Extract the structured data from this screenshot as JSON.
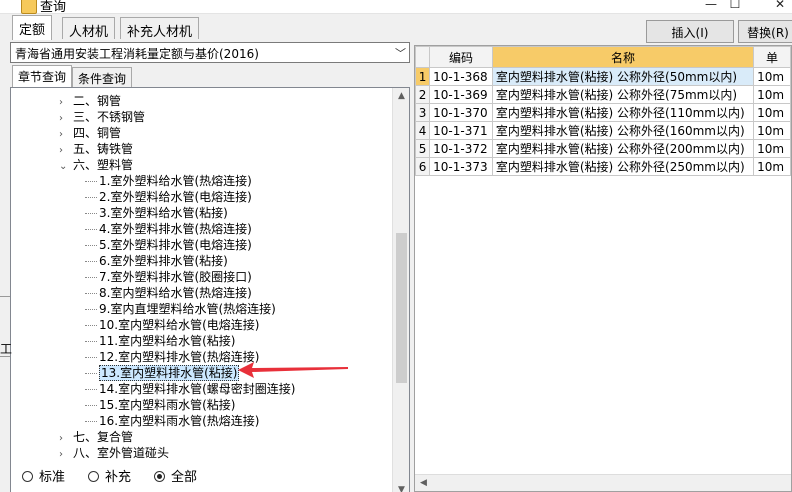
{
  "window": {
    "title": "查询",
    "minimize": "—",
    "maximize": "☐",
    "close": "✕"
  },
  "top_tabs": [
    {
      "label": "定额",
      "active": true
    },
    {
      "label": "人材机",
      "active": false
    },
    {
      "label": "补充人材机",
      "active": false
    }
  ],
  "toolbar": {
    "insert_label": "插入(I)",
    "replace_label": "替换(R)"
  },
  "combo": {
    "value": "青海省通用安装工程消耗量定额与基价(2016)",
    "arrow": "﹀"
  },
  "sub_tabs": [
    {
      "label": "章节查询",
      "active": true
    },
    {
      "label": "条件查询",
      "active": false
    }
  ],
  "tree": {
    "items": [
      {
        "label": "二、钢管",
        "level": 1,
        "expander": "›"
      },
      {
        "label": "三、不锈钢管",
        "level": 1,
        "expander": "›"
      },
      {
        "label": "四、铜管",
        "level": 1,
        "expander": "›"
      },
      {
        "label": "五、铸铁管",
        "level": 1,
        "expander": "›"
      },
      {
        "label": "六、塑料管",
        "level": 1,
        "expander": "⌄"
      },
      {
        "label": "1.室外塑料给水管(热熔连接)",
        "level": 2
      },
      {
        "label": "2.室外塑料给水管(电熔连接)",
        "level": 2
      },
      {
        "label": "3.室外塑料给水管(粘接)",
        "level": 2
      },
      {
        "label": "4.室外塑料排水管(热熔连接)",
        "level": 2
      },
      {
        "label": "5.室外塑料排水管(电熔连接)",
        "level": 2
      },
      {
        "label": "6.室外塑料排水管(粘接)",
        "level": 2
      },
      {
        "label": "7.室外塑料排水管(胶圈接口)",
        "level": 2
      },
      {
        "label": "8.室内塑料给水管(热熔连接)",
        "level": 2
      },
      {
        "label": "9.室内直埋塑料给水管(热熔连接)",
        "level": 2
      },
      {
        "label": "10.室内塑料给水管(电熔连接)",
        "level": 2
      },
      {
        "label": "11.室内塑料给水管(粘接)",
        "level": 2
      },
      {
        "label": "12.室内塑料排水管(热熔连接)",
        "level": 2
      },
      {
        "label": "13.室内塑料排水管(粘接)",
        "level": 2,
        "selected": true
      },
      {
        "label": "14.室内塑料排水管(螺母密封圈连接)",
        "level": 2
      },
      {
        "label": "15.室内塑料雨水管(粘接)",
        "level": 2
      },
      {
        "label": "16.室内塑料雨水管(热熔连接)",
        "level": 2
      },
      {
        "label": "七、复合管",
        "level": 1,
        "expander": "›"
      },
      {
        "label": "八、室外管道碰头",
        "level": 1,
        "expander": "›"
      }
    ]
  },
  "radios": [
    {
      "label": "标准",
      "checked": false
    },
    {
      "label": "补充",
      "checked": false
    },
    {
      "label": "全部",
      "checked": true
    }
  ],
  "grid": {
    "headers": [
      "编码",
      "名称",
      "单"
    ],
    "rows": [
      {
        "num": "1",
        "code": "10-1-368",
        "name": "室内塑料排水管(粘接) 公称外径(50mm以内)",
        "unit": "10m",
        "selected": true
      },
      {
        "num": "2",
        "code": "10-1-369",
        "name": "室内塑料排水管(粘接) 公称外径(75mm以内)",
        "unit": "10m"
      },
      {
        "num": "3",
        "code": "10-1-370",
        "name": "室内塑料排水管(粘接) 公称外径(110mm以内)",
        "unit": "10m"
      },
      {
        "num": "4",
        "code": "10-1-371",
        "name": "室内塑料排水管(粘接) 公称外径(160mm以内)",
        "unit": "10m"
      },
      {
        "num": "5",
        "code": "10-1-372",
        "name": "室内塑料排水管(粘接) 公称外径(200mm以内)",
        "unit": "10m"
      },
      {
        "num": "6",
        "code": "10-1-373",
        "name": "室内塑料排水管(粘接) 公称外径(250mm以内)",
        "unit": "10m"
      }
    ]
  },
  "edge_fragment": "工",
  "colors": {
    "header_highlight": "#f7cb68",
    "selection": "#cce8ff",
    "annotation_arrow": "#e8303a"
  }
}
